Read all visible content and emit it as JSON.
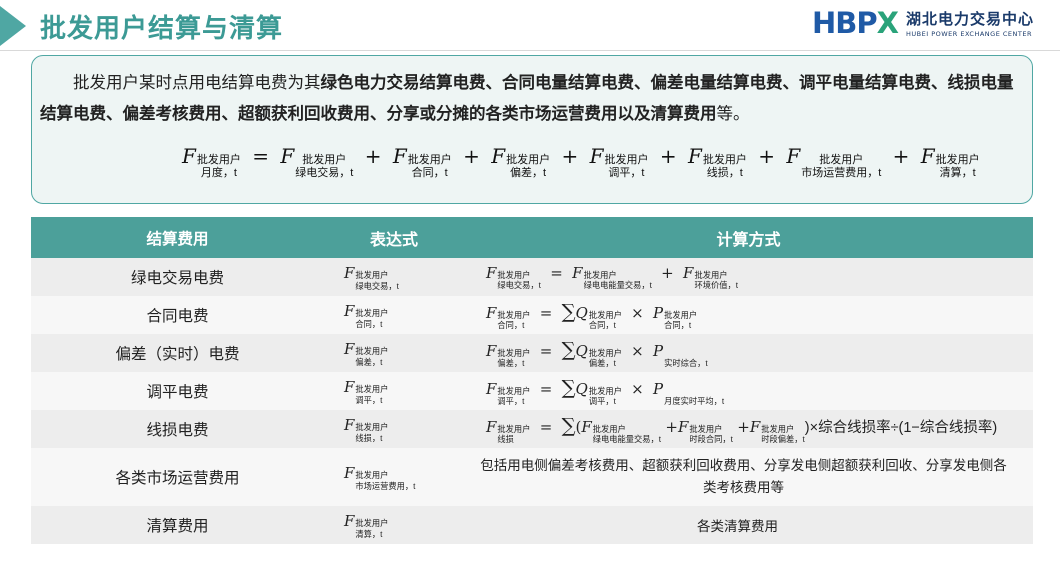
{
  "header": {
    "title": "批发用户结算与清算",
    "logo_mark_main": "HBP",
    "logo_mark_accent": "X",
    "logo_cn": "湖北电力交易中心",
    "logo_en": "HUBEI POWER EXCHANGE CENTER"
  },
  "intro": {
    "t1": "批发用户某时点用电结算电费为其",
    "b1": "绿色电力交易结算电费、合同电量结算电费、偏差电量结算电费、调平电量结算电费、线损电量结算电费、偏差考核费用、超额获利回收费用、分享或分摊的各类市场运营费用以及清算费用",
    "t2": "等。",
    "formula": {
      "lhs_sup": "批发用户",
      "lhs_sub": "月度，t",
      "terms": [
        {
          "sup": "批发用户",
          "sub": "绿电交易，t"
        },
        {
          "sup": "批发用户",
          "sub": "合同，t"
        },
        {
          "sup": "批发用户",
          "sub": "偏差，t"
        },
        {
          "sup": "批发用户",
          "sub": "调平，t"
        },
        {
          "sup": "批发用户",
          "sub": "线损，t"
        },
        {
          "sup": "批发用户",
          "sub": "市场运营费用，t"
        },
        {
          "sup": "批发用户",
          "sub": "清算，t"
        }
      ]
    }
  },
  "table": {
    "headers": [
      "结算费用",
      "表达式",
      "计算方式"
    ],
    "rows": [
      {
        "name": "绿电交易电费",
        "expr_sup": "批发用户",
        "expr_sub": "绿电交易，t"
      },
      {
        "name": "合同电费",
        "expr_sup": "批发用户",
        "expr_sub": "合同，t"
      },
      {
        "name": "偏差（实时）电费",
        "expr_sup": "批发用户",
        "expr_sub": "偏差，t"
      },
      {
        "name": "调平电费",
        "expr_sup": "批发用户",
        "expr_sub": "调平，t"
      },
      {
        "name": "线损电费",
        "expr_sup": "批发用户",
        "expr_sub": "线损，t"
      },
      {
        "name": "各类市场运营费用",
        "expr_sup": "批发用户",
        "expr_sub": "市场运营费用，t"
      },
      {
        "name": "清算费用",
        "expr_sup": "批发用户",
        "expr_sub": "清算，t"
      }
    ],
    "calc": {
      "r1": {
        "a_sup": "批发用户",
        "a_sub": "绿电交易，t",
        "b_sup": "批发用户",
        "b_sub": "绿电电能量交易，t",
        "c_sup": "批发用户",
        "c_sub": "环境价值，t"
      },
      "r2": {
        "a_sup": "批发用户",
        "a_sub": "合同，t",
        "q_sup": "批发用户",
        "q_sub": "合同，t",
        "p_sup": "批发用户",
        "p_sub": "合同，t"
      },
      "r3": {
        "a_sup": "批发用户",
        "a_sub": "偏差，t",
        "q_sup": "批发用户",
        "q_sub": "偏差，t",
        "p_sub": "实时综合，t"
      },
      "r4": {
        "a_sup": "批发用户",
        "a_sub": "调平，t",
        "q_sup": "批发用户",
        "q_sub": "调平，t",
        "p_sub": "月度实时平均，t"
      },
      "r5": {
        "a_sup": "批发用户",
        "a_sub": "线损",
        "b_sup": "批发用户",
        "b_sub": "绿电电能量交易，t",
        "c_sup": "批发用户",
        "c_sub": "时段合同，t",
        "d_sup": "批发用户",
        "d_sub": "时段偏差，t",
        "tail": ")×综合线损率÷(1−综合线损率)"
      },
      "r6": "包括用电侧偏差考核费用、超额获利回收费用、分享发电侧超额获利回收、分享发电侧各类考核费用等",
      "r7": "各类清算费用"
    }
  }
}
